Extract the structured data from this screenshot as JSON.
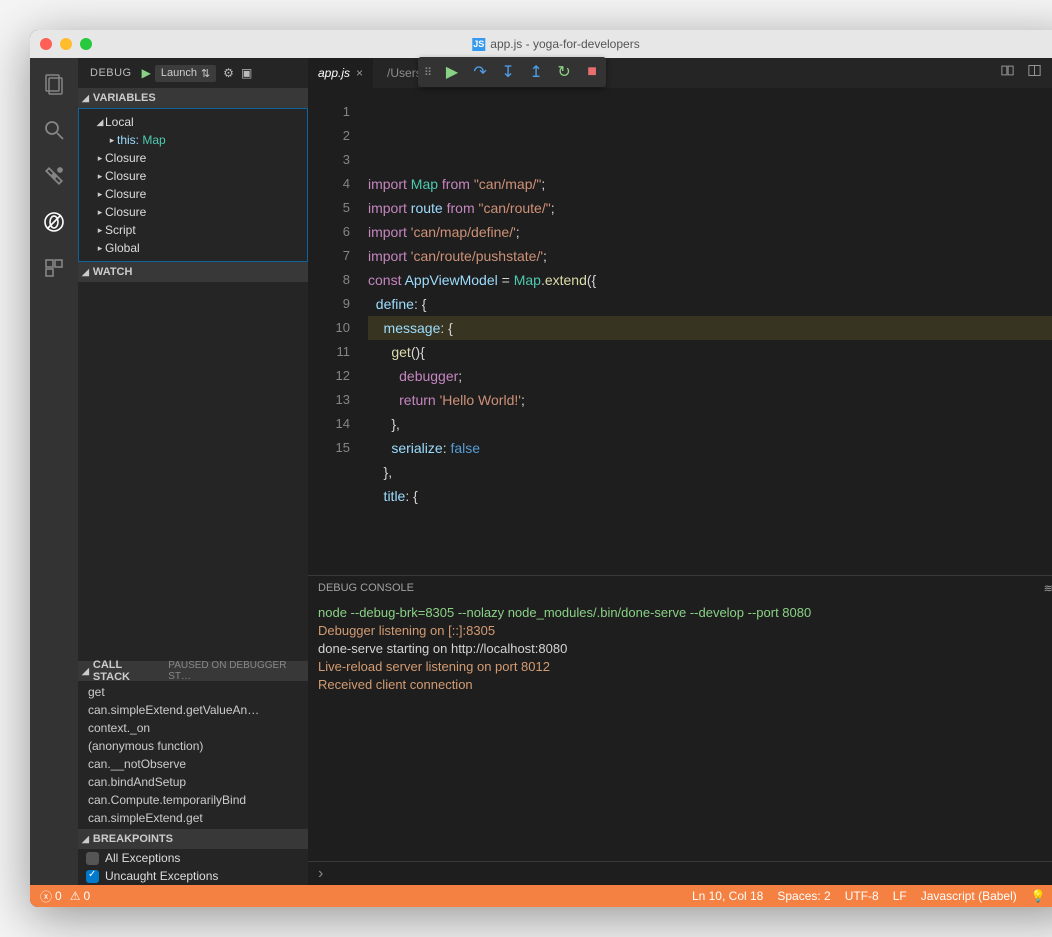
{
  "window": {
    "title": "app.js - yoga-for-developers"
  },
  "debug_header": {
    "label": "DEBUG",
    "config": "Launch"
  },
  "sections": {
    "variables": "VARIABLES",
    "watch": "WATCH",
    "callstack": "CALL STACK",
    "callstack_status": "PAUSED ON DEBUGGER ST…",
    "breakpoints": "BREAKPOINTS"
  },
  "variables": {
    "scopes": [
      "Local",
      "Closure",
      "Closure",
      "Closure",
      "Closure",
      "Script",
      "Global"
    ],
    "this_label": "this:",
    "this_value": "Map"
  },
  "callstack": [
    "get",
    "can.simpleExtend.getValueAn…",
    "context._on",
    "(anonymous function)",
    "can.__notObserve",
    "can.bindAndSetup",
    "can.Compute.temporarilyBind",
    "can.simpleExtend.get"
  ],
  "breakpoints": {
    "all": "All Exceptions",
    "uncaught": "Uncaught Exceptions"
  },
  "tab": {
    "name": "app.js",
    "breadcrumb": "/Users/m                                      /src/app.js!eval"
  },
  "editor": {
    "lines": [
      [
        [
          "import ",
          "key"
        ],
        [
          "Map ",
          "var"
        ],
        [
          "from ",
          "key"
        ],
        [
          "\"can/map/\"",
          "str"
        ],
        [
          ";",
          "pun"
        ]
      ],
      [
        [
          "import ",
          "key"
        ],
        [
          "route ",
          "fn"
        ],
        [
          "from ",
          "key"
        ],
        [
          "\"can/route/\"",
          "str"
        ],
        [
          ";",
          "pun"
        ]
      ],
      [
        [
          "import ",
          "key"
        ],
        [
          "'can/map/define/'",
          "str"
        ],
        [
          ";",
          "pun"
        ]
      ],
      [
        [
          "import ",
          "key"
        ],
        [
          "'can/route/pushstate/'",
          "str"
        ],
        [
          ";",
          "pun"
        ]
      ],
      [
        [
          "",
          "pun"
        ]
      ],
      [
        [
          "const ",
          "key"
        ],
        [
          "AppViewModel ",
          "fn"
        ],
        [
          "= ",
          "pun"
        ],
        [
          "Map",
          "var"
        ],
        [
          ".",
          "pun"
        ],
        [
          "extend",
          "id"
        ],
        [
          "({",
          "pun"
        ]
      ],
      [
        [
          "  define",
          "prop"
        ],
        [
          ": {",
          "pun"
        ]
      ],
      [
        [
          "    message",
          "prop"
        ],
        [
          ": {",
          "pun"
        ]
      ],
      [
        [
          "      ",
          "pun"
        ],
        [
          "get",
          "id"
        ],
        [
          "(){",
          "pun"
        ]
      ],
      [
        [
          "        ",
          "pun"
        ],
        [
          "debugger",
          "key"
        ],
        [
          ";",
          "pun"
        ]
      ],
      [
        [
          "        ",
          "pun"
        ],
        [
          "return ",
          "key"
        ],
        [
          "'Hello World!'",
          "str"
        ],
        [
          ";",
          "pun"
        ]
      ],
      [
        [
          "      },",
          "pun"
        ]
      ],
      [
        [
          "      serialize",
          "prop"
        ],
        [
          ": ",
          "pun"
        ],
        [
          "false",
          "const"
        ]
      ],
      [
        [
          "    },",
          "pun"
        ]
      ],
      [
        [
          "    title",
          "prop"
        ],
        [
          ": {",
          "pun"
        ]
      ]
    ],
    "highlight_line": 10
  },
  "panel": {
    "title": "DEBUG CONSOLE",
    "lines": [
      [
        "node --debug-brk=8305 --nolazy node_modules/.bin/done-serve --develop --port 8080",
        "green"
      ],
      [
        "Debugger listening on [::]:8305",
        "orange"
      ],
      [
        "done-serve starting on http://localhost:8080",
        "white"
      ],
      [
        "Live-reload server listening on port 8012",
        "orange"
      ],
      [
        "Received client connection",
        "orange"
      ]
    ]
  },
  "status": {
    "errors": "0",
    "warnings": "0",
    "cursor": "Ln 10, Col 18",
    "spaces": "Spaces: 2",
    "encoding": "UTF-8",
    "eol": "LF",
    "lang": "Javascript (Babel)"
  }
}
